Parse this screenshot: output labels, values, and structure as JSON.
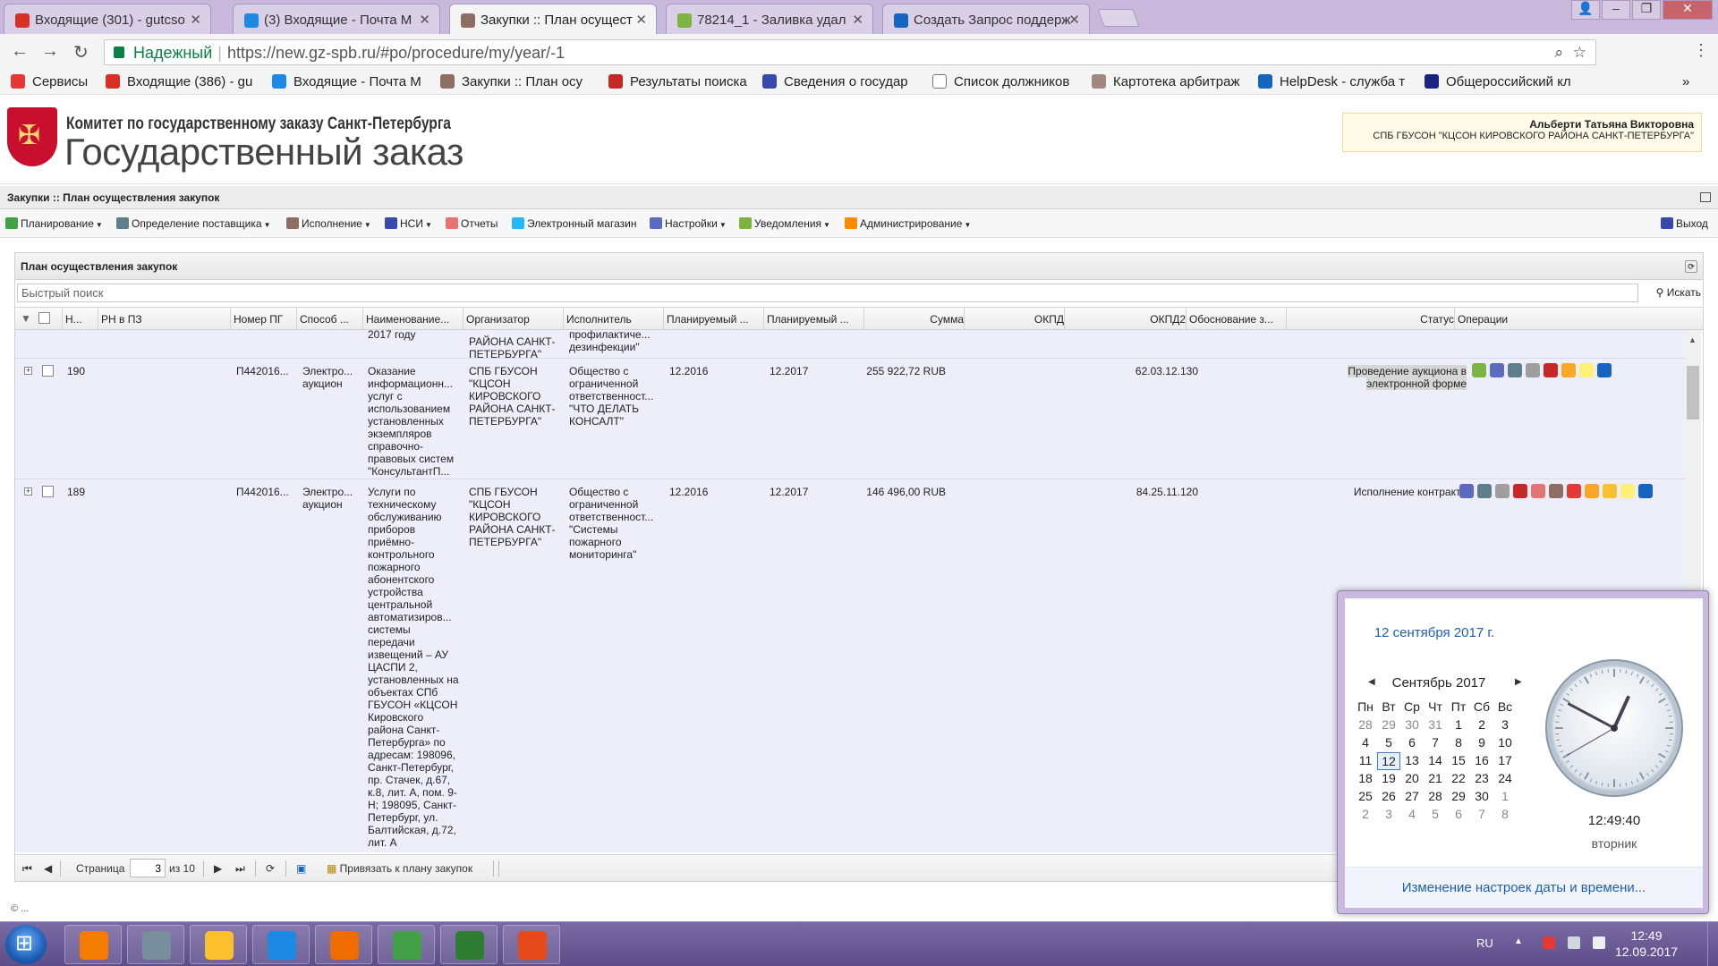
{
  "browser": {
    "tabs": [
      {
        "title": "Входящие (301) - gutcso",
        "favicon_color": "#d93025"
      },
      {
        "title": "(3) Входящие - Почта M",
        "favicon_color": "#1e88e5"
      },
      {
        "title": "Закупки :: План осущест",
        "favicon_color": "#8d6e63",
        "active": true
      },
      {
        "title": "78214_1 - Заливка удал",
        "favicon_color": "#7cb342"
      },
      {
        "title": "Создать Запрос поддерж",
        "favicon_color": "#1565c0"
      }
    ],
    "security_label": "Надежный",
    "url": "https://new.gz-spb.ru/#po/procedure/my/year/-1",
    "bookmarks": [
      {
        "label": "Сервисы",
        "color": "#e53935"
      },
      {
        "label": "Входящие (386) - gu",
        "color": "#d93025"
      },
      {
        "label": "Входящие - Почта М",
        "color": "#1e88e5"
      },
      {
        "label": "Закупки :: План осу",
        "color": "#8d6e63"
      },
      {
        "label": "Результаты поиска",
        "color": "#c62828"
      },
      {
        "label": "Сведения о государ",
        "color": "#3949ab"
      },
      {
        "label": "Список должников",
        "color": "#ffffff"
      },
      {
        "label": "Картотека арбитраж",
        "color": "#a1887f"
      },
      {
        "label": "HelpDesk - служба т",
        "color": "#1565c0"
      },
      {
        "label": "Общероссийский кл",
        "color": "#1a237e"
      }
    ],
    "bookmarks_more": "»"
  },
  "site": {
    "committee": "Комитет по государственному заказу Санкт-Петербурга",
    "title": "Государственный заказ",
    "user_name": "Альберти Татьяна Викторовна",
    "user_org": "СПБ ГБУСОН \"КЦСОН КИРОВСКОГО РАЙОНА САНКТ-ПЕТЕРБУРГА\""
  },
  "app": {
    "breadcrumb": "Закупки :: План осуществления закупок",
    "menu": [
      {
        "label": "Планирование",
        "dropdown": true,
        "color": "#43a047"
      },
      {
        "label": "Определение поставщика",
        "dropdown": true,
        "color": "#607d8b"
      },
      {
        "label": "Исполнение",
        "dropdown": true,
        "color": "#8d6e63"
      },
      {
        "label": "НСИ",
        "dropdown": true,
        "color": "#3949ab"
      },
      {
        "label": "Отчеты",
        "dropdown": false,
        "color": "#e57373"
      },
      {
        "label": "Электронный магазин",
        "dropdown": false,
        "color": "#29b6f6"
      },
      {
        "label": "Настройки",
        "dropdown": true,
        "color": "#5c6bc0"
      },
      {
        "label": "Уведомления",
        "dropdown": true,
        "color": "#7cb342"
      },
      {
        "label": "Администрирование",
        "dropdown": true,
        "color": "#fb8c00"
      }
    ],
    "logout": "Выход"
  },
  "panel": {
    "title": "План осуществления закупок",
    "search_placeholder": "Быстрый поиск",
    "search_button": "Искать",
    "columns": [
      "Н...",
      "РН в ПЗ",
      "Номер ПГ",
      "Способ ...",
      "Наименование...",
      "Организатор",
      "Исполнитель",
      "Планируемый ...",
      "Планируемый ...",
      "Сумма",
      "ОКПД",
      "ОКПД2",
      "Обоснование з...",
      "Статус",
      "Операции"
    ],
    "partial_row": {
      "name": "2017 году",
      "organizer": "РАЙОНА САНКТ-ПЕТЕРБУРГА\"",
      "executor": "профилактиче... дезинфекции\""
    },
    "rows": [
      {
        "num": "190",
        "pg": "П442016...",
        "method": "Электро... аукцион",
        "name": "Оказание информационн... услуг с использованием установленных экземпляров справочно-правовых систем \"КонсультантП...",
        "organizer": "СПБ ГБУСОН \"КЦСОН КИРОВСКОГО РАЙОНА САНКТ-ПЕТЕРБУРГА\"",
        "executor": "Общество с ограниченной ответственност... \"ЧТО ДЕЛАТЬ КОНСАЛТ\"",
        "plan1": "12.2016",
        "plan2": "12.2017",
        "sum": "255 922,72 RUB",
        "okpd": "",
        "okpd2": "62.03.12.130",
        "reason": "",
        "status": "Проведение аукциона в электронной форме",
        "op_colors": [
          "#7cb342",
          "#5c6bc0",
          "#607d8b",
          "#9e9e9e",
          "#c62828",
          "#f9a825",
          "#fff176",
          "#1565c0"
        ]
      },
      {
        "num": "189",
        "pg": "П442016...",
        "method": "Электро... аукцион",
        "name": "Услуги по техническому обслуживанию приборов приёмно-контрольного пожарного абонентского устройства центральной автоматизиров... системы передачи извещений – АУ ЦАСПИ 2, установленных на объектах СПб ГБУСОН «КЦСОН Кировского района Санкт-Петербурга» по адресам: 198096, Санкт-Петербург, пр. Стачек, д.67, к.8, лит. А, пом. 9-Н; 198095, Санкт-Петербург, ул. Балтийская, д.72, лит. А",
        "organizer": "СПБ ГБУСОН \"КЦСОН КИРОВСКОГО РАЙОНА САНКТ-ПЕТЕРБУРГА\"",
        "executor": "Общество с ограниченной ответственност... \"Системы пожарного мониторинга\"",
        "plan1": "12.2016",
        "plan2": "12.2017",
        "sum": "146 496,00 RUB",
        "okpd": "",
        "okpd2": "84.25.11.120",
        "reason": "",
        "status": "Исполнение контракта",
        "op_colors": [
          "#5c6bc0",
          "#607d8b",
          "#9e9e9e",
          "#c62828",
          "#e57373",
          "#8d6e63",
          "#e53935",
          "#f9a825",
          "#fbc02d",
          "#fff176",
          "#1565c0"
        ]
      }
    ],
    "pager": {
      "page_label": "Страница",
      "page": "3",
      "of_label": "из 10",
      "bind_label": "Привязать к плану закупок"
    }
  },
  "footer": "© ...",
  "calendar": {
    "full_date": "12 сентября 2017 г.",
    "month_label": "Сентябрь 2017",
    "weekdays": [
      "Пн",
      "Вт",
      "Ср",
      "Чт",
      "Пт",
      "Сб",
      "Вс"
    ],
    "weeks": [
      [
        "28",
        "29",
        "30",
        "31",
        "1",
        "2",
        "3"
      ],
      [
        "4",
        "5",
        "6",
        "7",
        "8",
        "9",
        "10"
      ],
      [
        "11",
        "12",
        "13",
        "14",
        "15",
        "16",
        "17"
      ],
      [
        "18",
        "19",
        "20",
        "21",
        "22",
        "23",
        "24"
      ],
      [
        "25",
        "26",
        "27",
        "28",
        "29",
        "30",
        "1"
      ],
      [
        "2",
        "3",
        "4",
        "5",
        "6",
        "7",
        "8"
      ]
    ],
    "today": "12",
    "time": "12:49:40",
    "weekday": "вторник",
    "settings_link": "Изменение настроек даты и времени..."
  },
  "taskbar": {
    "apps": [
      {
        "name": "app-1",
        "color": "#f57c00"
      },
      {
        "name": "app-2",
        "color": "#78909c"
      },
      {
        "name": "explorer",
        "color": "#fbc02d"
      },
      {
        "name": "internet-explorer",
        "color": "#1e88e5"
      },
      {
        "name": "firefox",
        "color": "#ef6c00"
      },
      {
        "name": "chrome",
        "color": "#43a047"
      },
      {
        "name": "excel",
        "color": "#2e7d32"
      },
      {
        "name": "app-8",
        "color": "#e64a19"
      }
    ],
    "lang": "RU",
    "time": "12:49",
    "date": "12.09.2017"
  }
}
